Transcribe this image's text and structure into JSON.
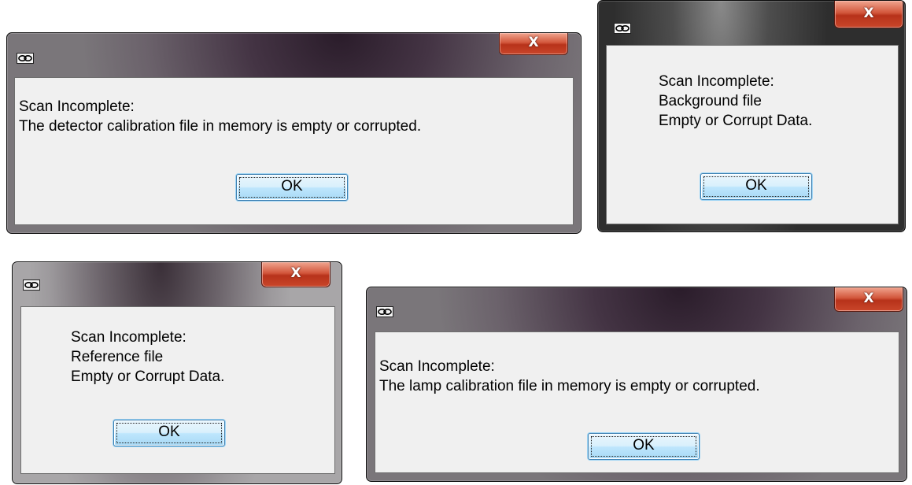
{
  "dialogs": [
    {
      "close_glyph": "X",
      "message_lines": [
        "Scan Incomplete:",
        "The detector calibration file in memory is empty or corrupted."
      ],
      "ok_label": "OK",
      "icon": "app-link-icon"
    },
    {
      "close_glyph": "X",
      "message_lines": [
        "Scan Incomplete:",
        "Background file",
        "Empty or Corrupt Data."
      ],
      "ok_label": "OK",
      "icon": "app-link-icon"
    },
    {
      "close_glyph": "X",
      "message_lines": [
        "Scan Incomplete:",
        "Reference file",
        "Empty or Corrupt Data."
      ],
      "ok_label": "OK",
      "icon": "app-link-icon"
    },
    {
      "close_glyph": "X",
      "message_lines": [
        "Scan Incomplete:",
        "The lamp calibration file in memory is empty or corrupted."
      ],
      "ok_label": "OK",
      "icon": "app-link-icon"
    }
  ],
  "colors": {
    "close_button": "#c9462a",
    "client_background": "#f0f0f0",
    "ok_border": "#3c7fb1"
  }
}
